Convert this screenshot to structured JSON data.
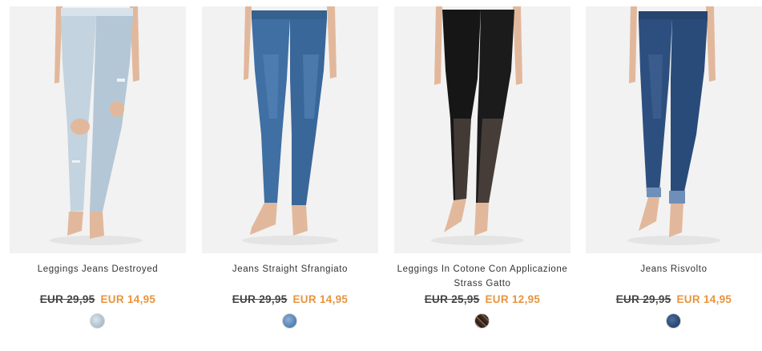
{
  "products": [
    {
      "name": "Leggings Jeans Destroyed",
      "price_old": "EUR 29,95",
      "price_new": "EUR 14,95",
      "swatch": "light-denim",
      "colors": {
        "denim": "#c3d3df",
        "shade": "#a7bccb"
      }
    },
    {
      "name": "Jeans Straight Sfrangiato",
      "price_old": "EUR 29,95",
      "price_new": "EUR 14,95",
      "swatch": "medium-denim",
      "colors": {
        "denim": "#3f6fa3",
        "shade": "#2f5686"
      }
    },
    {
      "name": "Leggings In Cotone Con Applicazione Strass Gatto",
      "price_old": "EUR 25,95",
      "price_new": "EUR 12,95",
      "swatch": "black-cat-print",
      "colors": {
        "denim": "#161616",
        "shade": "#050505"
      }
    },
    {
      "name": "Jeans Risvolto",
      "price_old": "EUR 29,95",
      "price_new": "EUR 14,95",
      "swatch": "dark-denim",
      "colors": {
        "denim": "#2c4f7f",
        "shade": "#1f3b63"
      }
    }
  ],
  "theme": {
    "sale_color": "#e8943d",
    "text_color": "#333333",
    "photo_bg": "#f2f2f2",
    "skin": "#e2b89c"
  }
}
